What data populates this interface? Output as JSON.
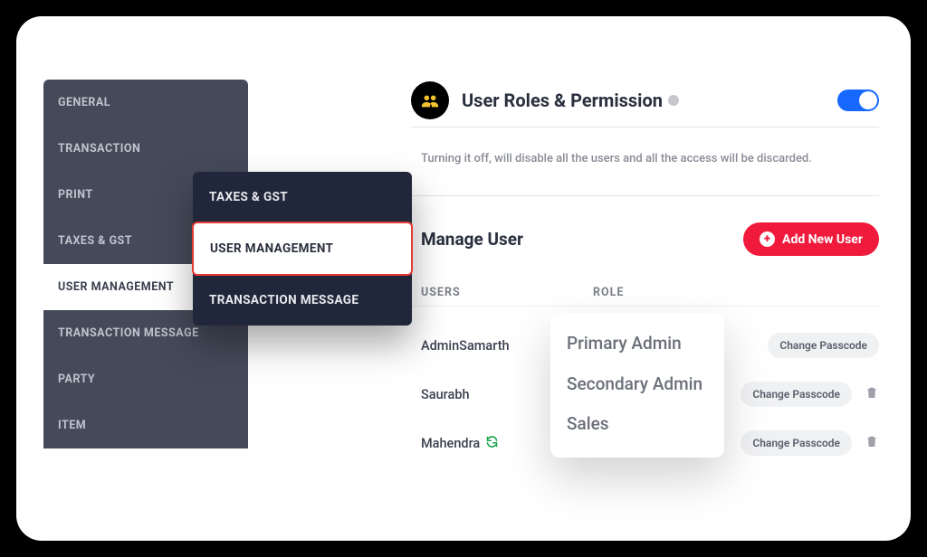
{
  "sidebar_back": {
    "items": [
      {
        "label": "GENERAL"
      },
      {
        "label": "TRANSACTION"
      },
      {
        "label": "PRINT"
      },
      {
        "label": "TAXES & GST"
      },
      {
        "label": "USER MANAGEMENT"
      },
      {
        "label": "TRANSACTION MESSAGE"
      },
      {
        "label": "PARTY"
      },
      {
        "label": "ITEM"
      }
    ]
  },
  "sidebar_pop": {
    "items": [
      {
        "label": "TAXES & GST"
      },
      {
        "label": "USER MANAGEMENT"
      },
      {
        "label": "TRANSACTION MESSAGE"
      }
    ]
  },
  "header": {
    "title": "User Roles & Permission"
  },
  "help_text": "Turning it off, will disable all the users and all the access will be discarded.",
  "manage": {
    "title": "Manage User",
    "add_btn": "Add New User"
  },
  "table": {
    "col_users": "USERS",
    "col_role": "ROLE"
  },
  "users": [
    {
      "name": "AdminSamarth",
      "sync": false,
      "action": "Change Passcode",
      "trash": false
    },
    {
      "name": "Saurabh",
      "sync": false,
      "action": "Change Passcode",
      "trash": true
    },
    {
      "name": "Mahendra",
      "sync": true,
      "action": "Change Passcode",
      "trash": true
    }
  ],
  "role_popover": {
    "options": [
      {
        "label": "Primary Admin"
      },
      {
        "label": "Secondary Admin"
      },
      {
        "label": "Sales"
      }
    ]
  }
}
